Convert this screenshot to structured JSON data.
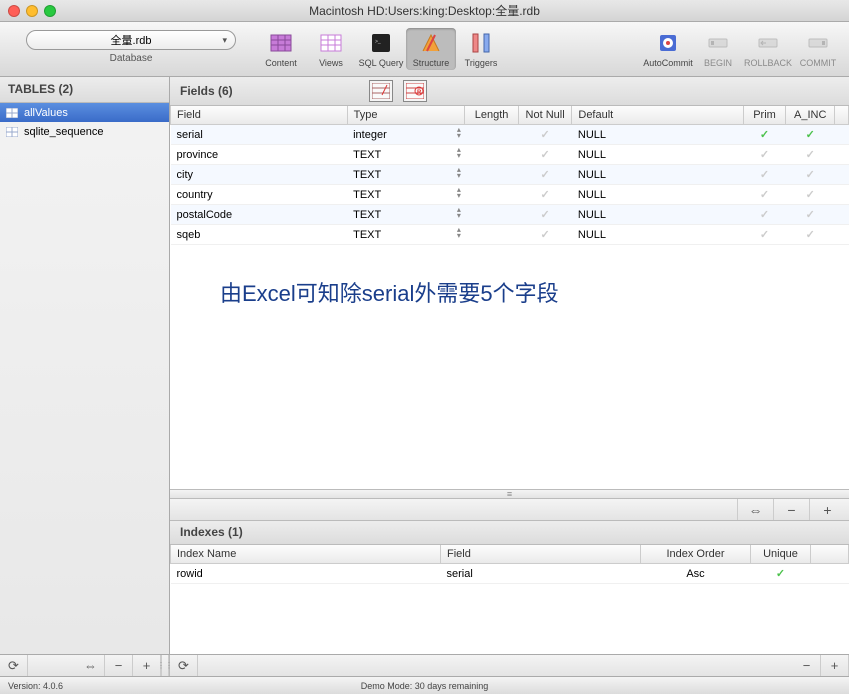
{
  "window": {
    "title": "Macintosh HD:Users:king:Desktop:全量.rdb"
  },
  "toolbar": {
    "database_combo": "全量.rdb",
    "database_label": "Database",
    "buttons": {
      "content": "Content",
      "views": "Views",
      "sqlquery": "SQL Query",
      "structure": "Structure",
      "triggers": "Triggers",
      "autocommit": "AutoCommit",
      "begin": "BEGIN",
      "rollback": "ROLLBACK",
      "commit": "COMMIT"
    }
  },
  "sidebar": {
    "header": "TABLES (2)",
    "items": [
      {
        "name": "allValues",
        "selected": true
      },
      {
        "name": "sqlite_sequence",
        "selected": false
      }
    ]
  },
  "fields": {
    "header": "Fields (6)",
    "columns": {
      "field": "Field",
      "type": "Type",
      "length": "Length",
      "notnull": "Not Null",
      "default": "Default",
      "prim": "Prim",
      "ainc": "A_INC"
    },
    "rows": [
      {
        "field": "serial",
        "type": "integer",
        "length": "",
        "notnull": false,
        "default": "NULL",
        "prim": true,
        "ainc": true
      },
      {
        "field": "province",
        "type": "TEXT",
        "length": "",
        "notnull": false,
        "default": "NULL",
        "prim": false,
        "ainc": false
      },
      {
        "field": "city",
        "type": "TEXT",
        "length": "",
        "notnull": false,
        "default": "NULL",
        "prim": false,
        "ainc": false
      },
      {
        "field": "country",
        "type": "TEXT",
        "length": "",
        "notnull": false,
        "default": "NULL",
        "prim": false,
        "ainc": false
      },
      {
        "field": "postalCode",
        "type": "TEXT",
        "length": "",
        "notnull": false,
        "default": "NULL",
        "prim": false,
        "ainc": false
      },
      {
        "field": "sqeb",
        "type": "TEXT",
        "length": "",
        "notnull": false,
        "default": "NULL",
        "prim": false,
        "ainc": false
      }
    ]
  },
  "annotation": "由Excel可知除serial外需要5个字段",
  "indexes": {
    "header": "Indexes (1)",
    "columns": {
      "name": "Index Name",
      "field": "Field",
      "order": "Index Order",
      "unique": "Unique"
    },
    "rows": [
      {
        "name": "rowid",
        "field": "serial",
        "order": "Asc",
        "unique": true
      }
    ]
  },
  "statusbar": {
    "version": "Version: 4.0.6",
    "demo": "Demo Mode: 30 days remaining"
  }
}
